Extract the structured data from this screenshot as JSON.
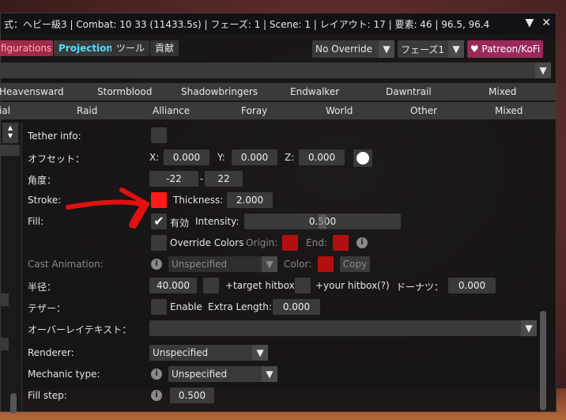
{
  "titlebar": {
    "title": "式：ヘビー級3 | Combat: 10 33 (11433.5s) | フェーズ: 1 | Scene: 1 | レイアウト: 17 | 要素: 46 | 96.5, 96.4",
    "collapse_icon": "triangle-down-icon",
    "close_icon": "close-icon"
  },
  "tabs": {
    "configurations": "figurations",
    "projection": "Projection",
    "tool": "ツール",
    "contrib": "貢献"
  },
  "override_combo": "No Override",
  "phase_combo": "フェーズ1",
  "patreon": "♥ Patreon/KoFi",
  "expansions": [
    "Heavensward",
    "Stormblood",
    "Shadowbringers",
    "Endwalker",
    "Dawntrail",
    "Mixed"
  ],
  "categories": [
    "ial",
    "Raid",
    "Alliance",
    "Foray",
    "World",
    "Other",
    "Mixed"
  ],
  "form": {
    "tether_info": "Tether info:",
    "offset_label": "オフセット：",
    "x_label": "X:",
    "x_val": "0.000",
    "y_label": "Y:",
    "y_val": "0.000",
    "z_label": "Z:",
    "z_val": "0.000",
    "angle_label": "角度：",
    "angle_min": "-22",
    "angle_sep": "-",
    "angle_max": "22",
    "stroke_label": "Stroke:",
    "thickness_label": "Thickness:",
    "thickness_val": "2.000",
    "fill_label": "Fill:",
    "enabled_label": "有効",
    "intensity_label": "Intensity:",
    "intensity_val": "0.500",
    "override_colors": "Override Colors",
    "origin_label": "Origin:",
    "end_label": "End:",
    "cast_anim_label": "Cast Animation:",
    "cast_anim_val": "Unspecified",
    "color_label": "Color:",
    "copy_label": "Copy",
    "radius_label": "半径：",
    "radius_val": "40.000",
    "target_hitbox": "+target hitbox",
    "your_hitbox": "+your hitbox",
    "q_mark": "(?)",
    "donut_label": "ドーナツ：",
    "donut_val": "0.000",
    "tether_label": "テザー：",
    "tether_enable": "Enable",
    "extra_length_label": "Extra Length:",
    "extra_length_val": "0.000",
    "overlay_text_label": "オーバーレイテキスト：",
    "renderer_label": "Renderer:",
    "renderer_val": "Unspecified",
    "mechanic_label": "Mechanic type:",
    "mechanic_val": "Unspecified",
    "fill_step_label": "Fill step:",
    "fill_step_val": "0.500"
  },
  "colors": {
    "stroke": "#ff1a1a",
    "origin": "#b01010",
    "end": "#b01010",
    "cast_color": "#b01010",
    "accent_projection": "#4de0ff",
    "patreon_bg": "#9a2a5a"
  }
}
